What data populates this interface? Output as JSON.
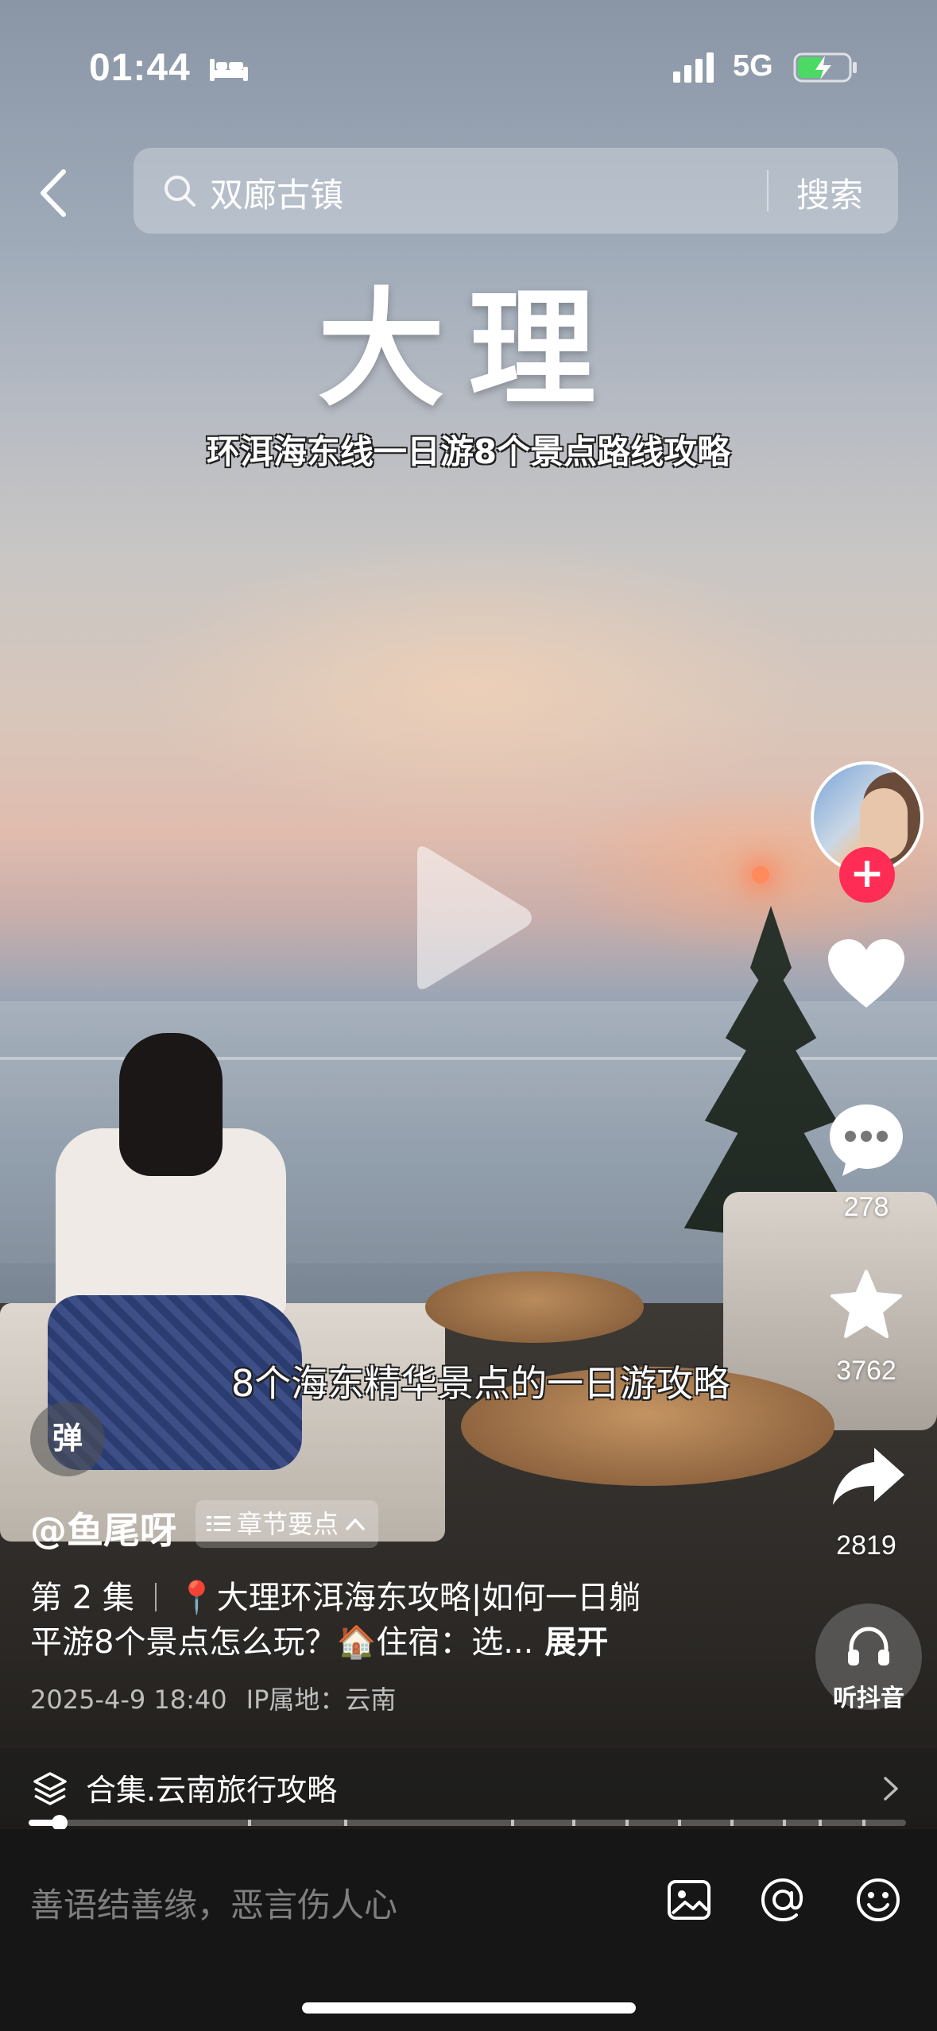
{
  "status_bar": {
    "time": "01:44",
    "network": "5G",
    "icons": [
      "bed-icon",
      "signal-icon",
      "battery-charging-icon"
    ]
  },
  "header": {
    "back_icon": "chevron-left-icon",
    "search_query": "双廊古镇",
    "search_button": "搜索"
  },
  "video": {
    "overlay_title": "大理",
    "overlay_subtitle": "环洱海东线一日游8个景点路线攻略",
    "caption": "8个海东精华景点的一日游攻略",
    "play_icon": "play-icon"
  },
  "actions": {
    "follow_label": "+",
    "like_count": "",
    "comment_count": "278",
    "favorite_count": "3762",
    "share_count": "2819",
    "listen_label": "听抖音"
  },
  "danmaku_label": "弹",
  "post": {
    "author": "@鱼尾呀",
    "chapter_label": "章节要点",
    "episode": "第 2 集",
    "description_line1": "📍大理环洱海东攻略|如何一日躺",
    "description_line2": "平游8个景点怎么玩？🏠住宿：选...",
    "expand_label": "展开",
    "date": "2025-4-9 18:40",
    "ip_location": "IP属地：云南"
  },
  "collection": {
    "label": "合集.云南旅行攻略"
  },
  "progress": {
    "played_fraction": 0.035,
    "chapter_marks": [
      0.04,
      0.25,
      0.36,
      0.55,
      0.62,
      0.68,
      0.74,
      0.8,
      0.86,
      0.9,
      0.95
    ]
  },
  "comment_bar": {
    "placeholder": "善语结善缘，恶言伤人心",
    "icons": [
      "image-icon",
      "mention-icon",
      "emoji-icon"
    ]
  },
  "colors": {
    "accent": "#ff2c55",
    "bottom_bar": "#161616"
  }
}
